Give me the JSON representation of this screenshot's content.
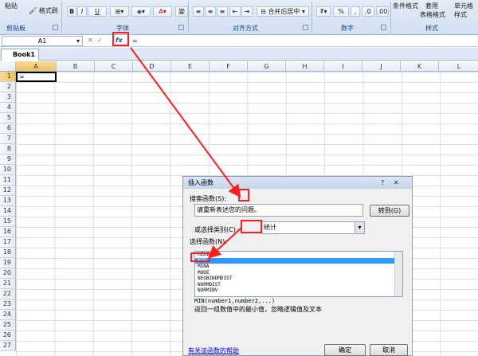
{
  "ribbon": {
    "paste_label": "粘贴",
    "format_painter_label": "格式刷",
    "clipboard_label": "剪贴板",
    "font_label": "字体",
    "alignment_label": "对齐方式",
    "number_label": "数字",
    "styles_label": "样式",
    "merge_center_label": "合并后居中",
    "percent_label": "%",
    "comma_label": ",",
    "conditional_format_label": "条件格式",
    "table_format_label": "表格格式",
    "table_label": "套用",
    "cell_style_label": "单元格",
    "cell_style_sub": "样式",
    "bold_label": "B",
    "italic_label": "I",
    "underline_label": "U",
    "font_color_label": "A",
    "phonetic_label": "變"
  },
  "formula_bar": {
    "name_box": "A1",
    "fx_label": "fx",
    "formula": "="
  },
  "workbook": {
    "tab": "Book1"
  },
  "sheet": {
    "columns": [
      "A",
      "B",
      "C",
      "D",
      "E",
      "F",
      "G",
      "H",
      "I",
      "J",
      "K",
      "L"
    ],
    "rows": [
      "1",
      "2",
      "3",
      "4",
      "5",
      "6",
      "7",
      "8",
      "9",
      "10",
      "11",
      "12",
      "13",
      "14",
      "15",
      "16",
      "17",
      "18",
      "19",
      "20",
      "21",
      "22",
      "23",
      "24",
      "25",
      "26",
      "27"
    ],
    "a1_value": "="
  },
  "dialog": {
    "title": "插入函数",
    "search_label": "搜索函数(S):",
    "search_value": "请重新表述您的问题。",
    "go_button": "转到(G)",
    "category_label": "或选择类别(C):",
    "category_value": "统计",
    "select_label": "选择函数(N):",
    "functions": [
      "MEDIAN",
      "MIN",
      "MINA",
      "MODE",
      "NEGBINOMDIST",
      "NORMDIST",
      "NORMINV"
    ],
    "selected_index": 1,
    "signature": "MIN(number1,number2,...)",
    "description": "返回一组数值中的最小值，忽略逻辑值及文本",
    "help_link": "有关该函数的帮助",
    "ok_button": "确定",
    "cancel_button": "取消"
  },
  "colors": {
    "highlight": "#ff1f1f",
    "selection": "#3399ff"
  }
}
